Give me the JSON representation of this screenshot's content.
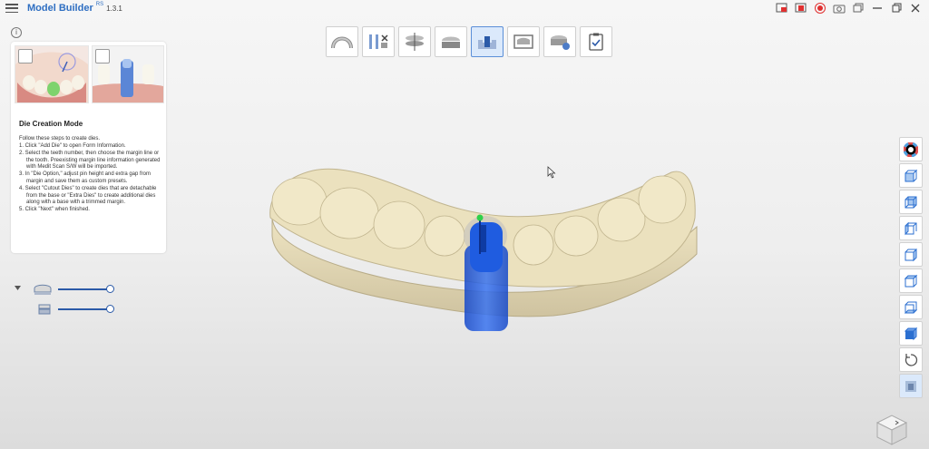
{
  "app": {
    "title": "Model Builder",
    "badge": "RS",
    "version": "1.3.1"
  },
  "window_controls": [
    "capture-window-icon",
    "record-window-icon",
    "record-icon",
    "camera-icon",
    "restore-window-icon",
    "maximize-icon",
    "close-icon"
  ],
  "workflow_steps": [
    {
      "name": "arch-step",
      "active": false
    },
    {
      "name": "tools-step",
      "active": false
    },
    {
      "name": "align-step",
      "active": false
    },
    {
      "name": "base-step",
      "active": false
    },
    {
      "name": "die-step",
      "active": true
    },
    {
      "name": "trim-step",
      "active": false
    },
    {
      "name": "export-step",
      "active": false
    },
    {
      "name": "finish-step",
      "active": false
    }
  ],
  "instructions": {
    "title": "Die Creation Mode",
    "intro": "Follow these steps to create dies.",
    "steps": [
      "1. Click \"Add Die\" to open Form Information.",
      "2. Select the teeth number, then choose the margin line or the tooth. Preexisting margin line information generated with Medit Scan S/W will be imported.",
      "3. In \"Die Option,\" adjust pin height and extra gap from margin and save them as custom presets.",
      "4. Select \"Cutout Dies\" to create dies that are detachable from the base or \"Extra Dies\" to create additional dies along with a base with a trimmed margin.",
      "5. Click \"Next\" when finished."
    ]
  },
  "layers": [
    {
      "name": "upper-model",
      "opacity": 1.0
    },
    {
      "name": "lower-model",
      "opacity": 1.0
    }
  ],
  "view_tools": [
    "color-wheel-icon",
    "view-front-icon",
    "view-back-icon",
    "view-left-icon",
    "view-right-icon",
    "view-top-icon",
    "view-bottom-icon",
    "view-iso-icon",
    "reset-view-icon",
    "display-mode-icon"
  ],
  "colors": {
    "brand": "#2f6fc2",
    "accent": "#2b5aa8",
    "model": "#e6dcb9",
    "die": "#1d56d6",
    "record": "#e03030"
  }
}
